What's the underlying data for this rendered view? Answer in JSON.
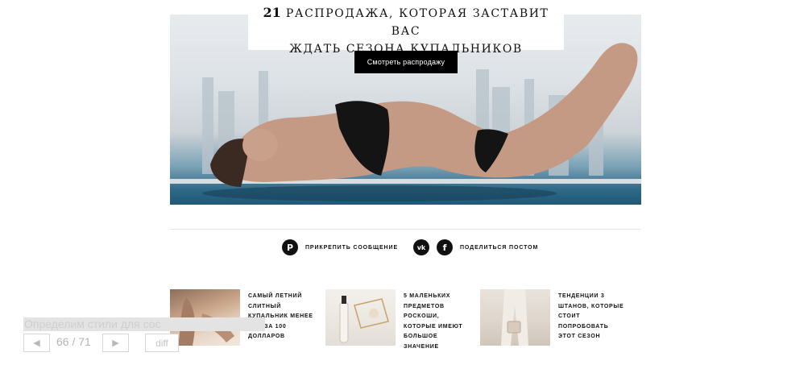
{
  "article": {
    "title_number": "21",
    "title_line1": "РАСПРОДАЖА, КОТОРАЯ ЗАСТАВИТ ВАС",
    "title_line2": "ЖДАТЬ СЕЗОНА КУПАЛЬНИКОВ",
    "cta_label": "Смотреть распродажу"
  },
  "share": {
    "pin_label": "ПРИКРЕПИТЬ СООБЩЕНИЕ",
    "share_label": "ПОДЕЛИТЬСЯ ПОСТОМ",
    "icons": [
      "pinterest-icon",
      "vk-icon",
      "facebook-icon"
    ]
  },
  "overlay": {
    "question_text": "Определим стили для сос",
    "prev_label": "◀",
    "next_label": "▶",
    "current_page": "66",
    "page_separator": " / ",
    "total_pages": "71",
    "diff_label": "diff"
  },
  "related": [
    {
      "text": "САМЫЙ ЛЕТНИЙ СЛИТНЫЙ КУПАЛЬНИК МЕНЕЕ ЧЕМ ЗА 100 ДОЛЛАРОВ"
    },
    {
      "text": "5 МАЛЕНЬКИХ ПРЕДМЕТОВ РОСКОШИ, КОТОРЫЕ ИМЕЮТ БОЛЬШОЕ ЗНАЧЕНИЕ"
    },
    {
      "text": "ТЕНДЕНЦИИ 3 ШТАНОВ, КОТОРЫЕ СТОИТ ПОПРОБОВАТЬ ЭТОТ СЕЗОН"
    }
  ],
  "colors": {
    "accent": "#000000",
    "water": "#1f5878",
    "sky": "#e4e8ec"
  }
}
